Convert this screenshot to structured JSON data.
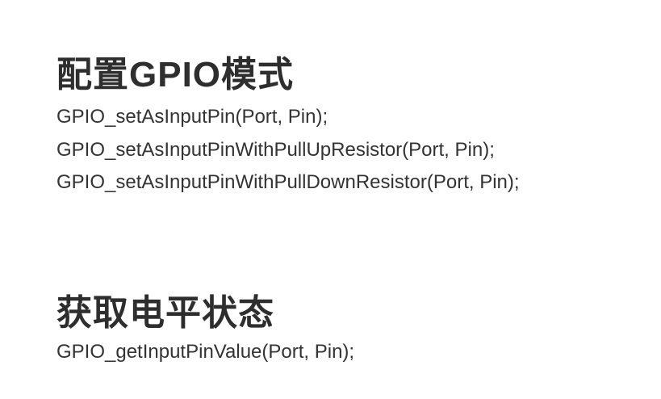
{
  "sections": [
    {
      "heading": "配置GPIO模式",
      "lines": [
        "GPIO_setAsInputPin(Port, Pin);",
        "GPIO_setAsInputPinWithPullUpResistor(Port, Pin);",
        "GPIO_setAsInputPinWithPullDownResistor(Port, Pin);"
      ]
    },
    {
      "heading": "获取电平状态",
      "lines": [
        "GPIO_getInputPinValue(Port, Pin);"
      ]
    }
  ]
}
